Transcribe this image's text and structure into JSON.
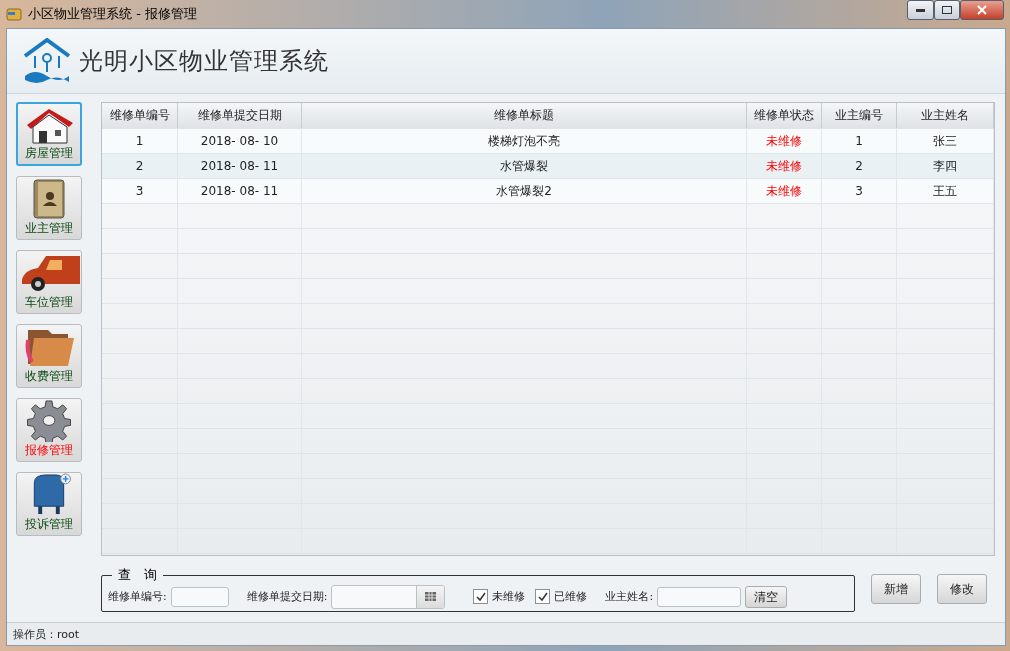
{
  "window": {
    "title": "小区物业管理系统 - 报修管理"
  },
  "header": {
    "title": "光明小区物业管理系统"
  },
  "sidebar": {
    "items": [
      {
        "label": "房屋管理",
        "selected": false,
        "focused": true
      },
      {
        "label": "业主管理",
        "selected": false,
        "focused": false
      },
      {
        "label": "车位管理",
        "selected": false,
        "focused": false
      },
      {
        "label": "收费管理",
        "selected": false,
        "focused": false
      },
      {
        "label": "报修管理",
        "selected": true,
        "focused": false
      },
      {
        "label": "投诉管理",
        "selected": false,
        "focused": false
      }
    ]
  },
  "table": {
    "columns": [
      "维修单编号",
      "维修单提交日期",
      "维修单标题",
      "维修单状态",
      "业主编号",
      "业主姓名"
    ],
    "rows": [
      [
        "1",
        "2018- 08- 10",
        "楼梯灯泡不亮",
        "未维修",
        "1",
        "张三"
      ],
      [
        "2",
        "2018- 08- 11",
        "水管爆裂",
        "未维修",
        "2",
        "李四"
      ],
      [
        "3",
        "2018- 08- 11",
        "水管爆裂2",
        "未维修",
        "3",
        "王五"
      ]
    ]
  },
  "query": {
    "legend": "查　询",
    "id_label": "维修单编号:",
    "date_label": "维修单提交日期:",
    "checkboxes": [
      {
        "label": "未维修",
        "checked": true
      },
      {
        "label": "已维修",
        "checked": true
      }
    ],
    "owner_label": "业主姓名:",
    "clear_button": "清空"
  },
  "buttons": [
    "新增",
    "修改"
  ],
  "status_bar": {
    "text": "操作员：root"
  }
}
